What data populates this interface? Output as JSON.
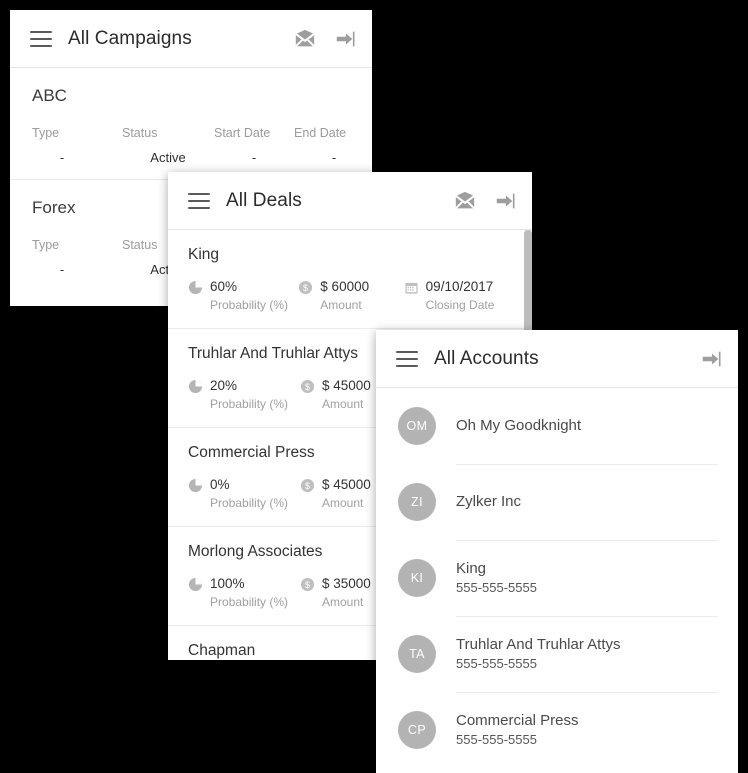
{
  "theme": {
    "background": "#000000",
    "card_background": "#ffffff",
    "title_color": "#2b2b2b",
    "muted_color": "#9b9b9b",
    "avatar_color": "#b3b3b3",
    "divider_color": "#ececec"
  },
  "campaigns_card": {
    "header": {
      "menu_icon": "hamburger-icon",
      "title": "All Campaigns",
      "actions": [
        {
          "icon": "envelope-icon",
          "name": "mail"
        },
        {
          "icon": "arrow-to-bar-icon",
          "name": "logout"
        }
      ]
    },
    "columns": [
      "Type",
      "Status",
      "Start Date",
      "End Date"
    ],
    "rows": [
      {
        "name": "ABC",
        "type": "-",
        "status": "Active",
        "start_date": "-",
        "end_date": "-"
      },
      {
        "name": "Forex",
        "type": "-",
        "status": "Active",
        "start_date": "",
        "end_date": ""
      }
    ]
  },
  "deals_card": {
    "header": {
      "menu_icon": "hamburger-icon",
      "title": "All Deals",
      "actions": [
        {
          "icon": "envelope-icon",
          "name": "mail"
        },
        {
          "icon": "arrow-to-bar-icon",
          "name": "logout"
        }
      ]
    },
    "metric_labels": {
      "probability": "Probability (%)",
      "amount": "Amount",
      "closing_date": "Closing Date"
    },
    "metric_icons": {
      "probability": "pie-chart-icon",
      "amount": "dollar-circle-icon",
      "closing_date": "calendar-icon"
    },
    "rows": [
      {
        "name": "King",
        "probability": "60%",
        "amount": "$ 60000",
        "closing_date": "09/10/2017",
        "show_date": true
      },
      {
        "name": "Truhlar And Truhlar Attys",
        "probability": "20%",
        "amount": "$ 45000",
        "closing_date": "",
        "show_date": false
      },
      {
        "name": "Commercial Press",
        "probability": "0%",
        "amount": "$ 45000",
        "closing_date": "",
        "show_date": false
      },
      {
        "name": "Morlong Associates",
        "probability": "100%",
        "amount": "$ 35000",
        "closing_date": "",
        "show_date": false
      },
      {
        "name": "Chapman",
        "probability": "",
        "amount": "",
        "closing_date": "",
        "show_date": false
      }
    ]
  },
  "accounts_card": {
    "header": {
      "menu_icon": "hamburger-icon",
      "title": "All Accounts",
      "actions": [
        {
          "icon": "arrow-to-bar-icon",
          "name": "logout"
        }
      ]
    },
    "rows": [
      {
        "initials": "OM",
        "name": "Oh My Goodknight",
        "phone": ""
      },
      {
        "initials": "ZI",
        "name": "Zylker Inc",
        "phone": ""
      },
      {
        "initials": "KI",
        "name": "King",
        "phone": "555-555-5555"
      },
      {
        "initials": "TA",
        "name": "Truhlar And Truhlar Attys",
        "phone": "555-555-5555"
      },
      {
        "initials": "CP",
        "name": "Commercial Press",
        "phone": "555-555-5555"
      }
    ]
  }
}
